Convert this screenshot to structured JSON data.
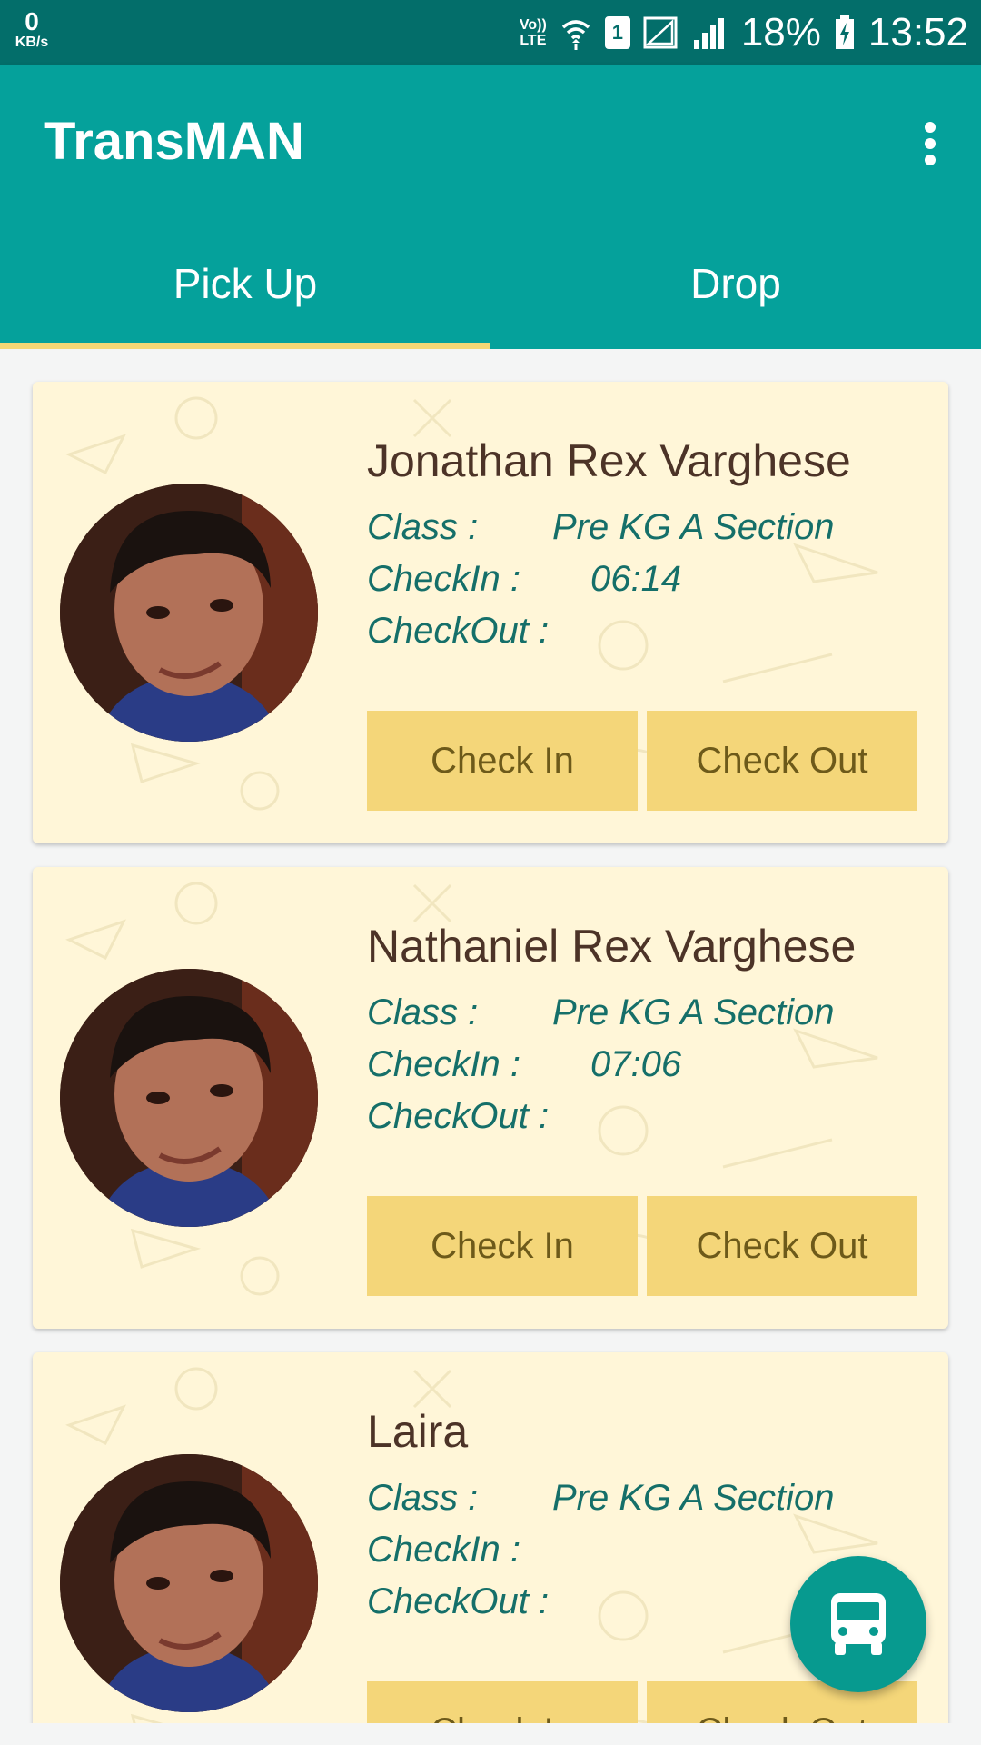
{
  "status_bar": {
    "speed_value": "0",
    "speed_unit": "KB/s",
    "network_label_top": "Vo))",
    "network_label_bottom": "LTE",
    "sim_number": "1",
    "battery_percent": "18%",
    "time": "13:52",
    "icons": [
      "wifi-icon",
      "sim-icon",
      "signal-icon",
      "signal-icon",
      "battery-charging-icon"
    ]
  },
  "app_bar": {
    "title": "TransMAN",
    "menu_icon": "more-vert-icon"
  },
  "tabs": [
    {
      "label": "Pick Up",
      "selected": true
    },
    {
      "label": "Drop",
      "selected": false
    }
  ],
  "labels": {
    "class": "Class  :",
    "checkin": "CheckIn :",
    "checkout": "CheckOut :"
  },
  "students": [
    {
      "name": "Jonathan Rex Varghese",
      "class_value": "Pre KG A Section",
      "checkin_value": "06:14",
      "checkout_value": "",
      "check_in_button": "Check In",
      "check_out_button": "Check Out"
    },
    {
      "name": "Nathaniel Rex Varghese",
      "class_value": "Pre KG A Section",
      "checkin_value": "07:06",
      "checkout_value": "",
      "check_in_button": "Check In",
      "check_out_button": "Check Out"
    },
    {
      "name": "Laira",
      "class_value": "Pre KG A Section",
      "checkin_value": "",
      "checkout_value": "",
      "check_in_button": "Check In",
      "check_out_button": "Check Out"
    }
  ],
  "fab": {
    "icon": "bus-icon"
  },
  "colors": {
    "primary": "#05a19b",
    "status_bar": "#036e6a",
    "tab_indicator": "#f5d775",
    "card_background": "#fff6d8",
    "button": "#f4d679",
    "info_text": "#156f69",
    "name_text": "#4c3327"
  }
}
